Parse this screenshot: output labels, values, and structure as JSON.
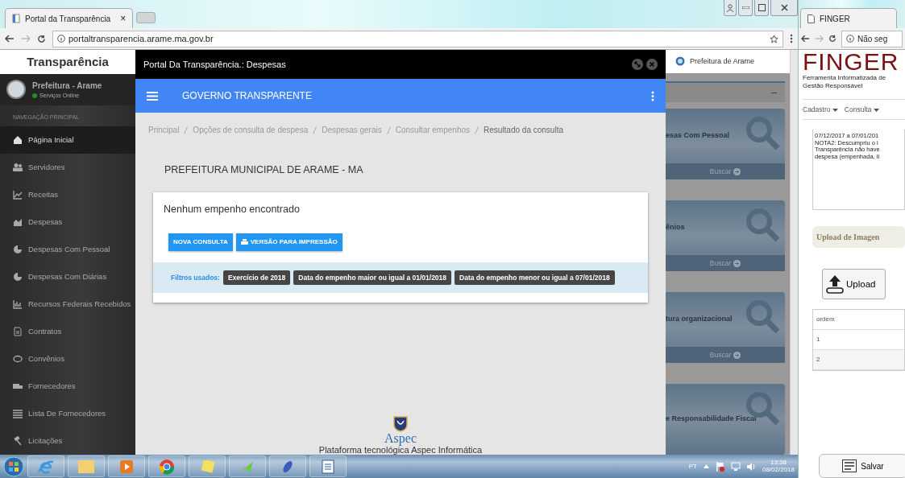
{
  "browser_left": {
    "tab_title": "Portal da Transparência",
    "tab_close": "×",
    "url": "portaltransparencia.arame.ma.gov.br"
  },
  "sidebar": {
    "title": "Transparência",
    "profile_name": "Prefeitura - Arame",
    "profile_status": "Serviços Online",
    "section": "NAVEGAÇÃO PRINCIPAL",
    "items": [
      {
        "label": "Página Inicial",
        "selected": true
      },
      {
        "label": "Servidores",
        "selected": false
      },
      {
        "label": "Receitas",
        "selected": false
      },
      {
        "label": "Despesas",
        "selected": false
      },
      {
        "label": "Despesas Com Pessoal",
        "selected": false
      },
      {
        "label": "Despesas Com Diárias",
        "selected": false
      },
      {
        "label": "Recursos Federais Recebidos",
        "selected": false
      },
      {
        "label": "Contratos",
        "selected": false
      },
      {
        "label": "Convênios",
        "selected": false
      },
      {
        "label": "Fornecedores",
        "selected": false
      },
      {
        "label": "Lista De Fornecedores",
        "selected": false
      },
      {
        "label": "Licitações",
        "selected": false
      }
    ]
  },
  "modal": {
    "title": "Portal Da Transparência.: Despesas",
    "app_title": "GOVERNO TRANSPARENTE",
    "breadcrumb": [
      {
        "label": "Principal",
        "selected": false
      },
      {
        "label": "Opções de consulta de despesa",
        "selected": false
      },
      {
        "label": "Despesas gerais",
        "selected": false
      },
      {
        "label": "Consultar empenhos",
        "selected": false
      },
      {
        "label": "Resultado da consulta",
        "selected": true
      }
    ],
    "heading": "PREFEITURA MUNICIPAL DE ARAME - MA",
    "message": "Nenhum empenho encontrado",
    "buttons": [
      "NOVA CONSULTA",
      "VERSÃO PARA IMPRESSÃO"
    ],
    "filters_label": "Filtros usados:",
    "filters": [
      "Exercício de 2018",
      "Data do empenho maior ou igual a 01/01/2018",
      "Data do empenho menor ou igual a 07/01/2018"
    ],
    "footer_logo": "Aspec",
    "footer_text": "Plataforma tecnológica Aspec Informática"
  },
  "background_page": {
    "org": "Prefeitura de Arame",
    "panel_toggle": "–",
    "cards": [
      {
        "title": "esas Com Pessoal",
        "action": "Buscar"
      },
      {
        "title": "ênios",
        "action": "Buscar"
      },
      {
        "title": "tura organizacional",
        "action": "Buscar"
      },
      {
        "title": "e Responsabilidade Fiscal"
      }
    ]
  },
  "browser_right": {
    "tab_title": "FINGER",
    "url": "Não seg",
    "logo": "FINGER",
    "subtitle": "Ferramenta Informatizada de Gestão Responsável",
    "menu": [
      "Cadastro",
      "Consulta"
    ],
    "notes": [
      "07/12/2017 a 07/01/201",
      "NOTA2: Descumpriu o i",
      "Transparência não have",
      "despesa (empenhada, li"
    ],
    "upload_heading": "Upload de Imagen",
    "upload_button": "Upload",
    "table": {
      "column": "ordem",
      "rows": [
        "1",
        "2"
      ]
    },
    "save_button": "Salvar"
  },
  "taskbar": {
    "language": "PT",
    "time": "13:38",
    "date": "08/02/2018"
  }
}
